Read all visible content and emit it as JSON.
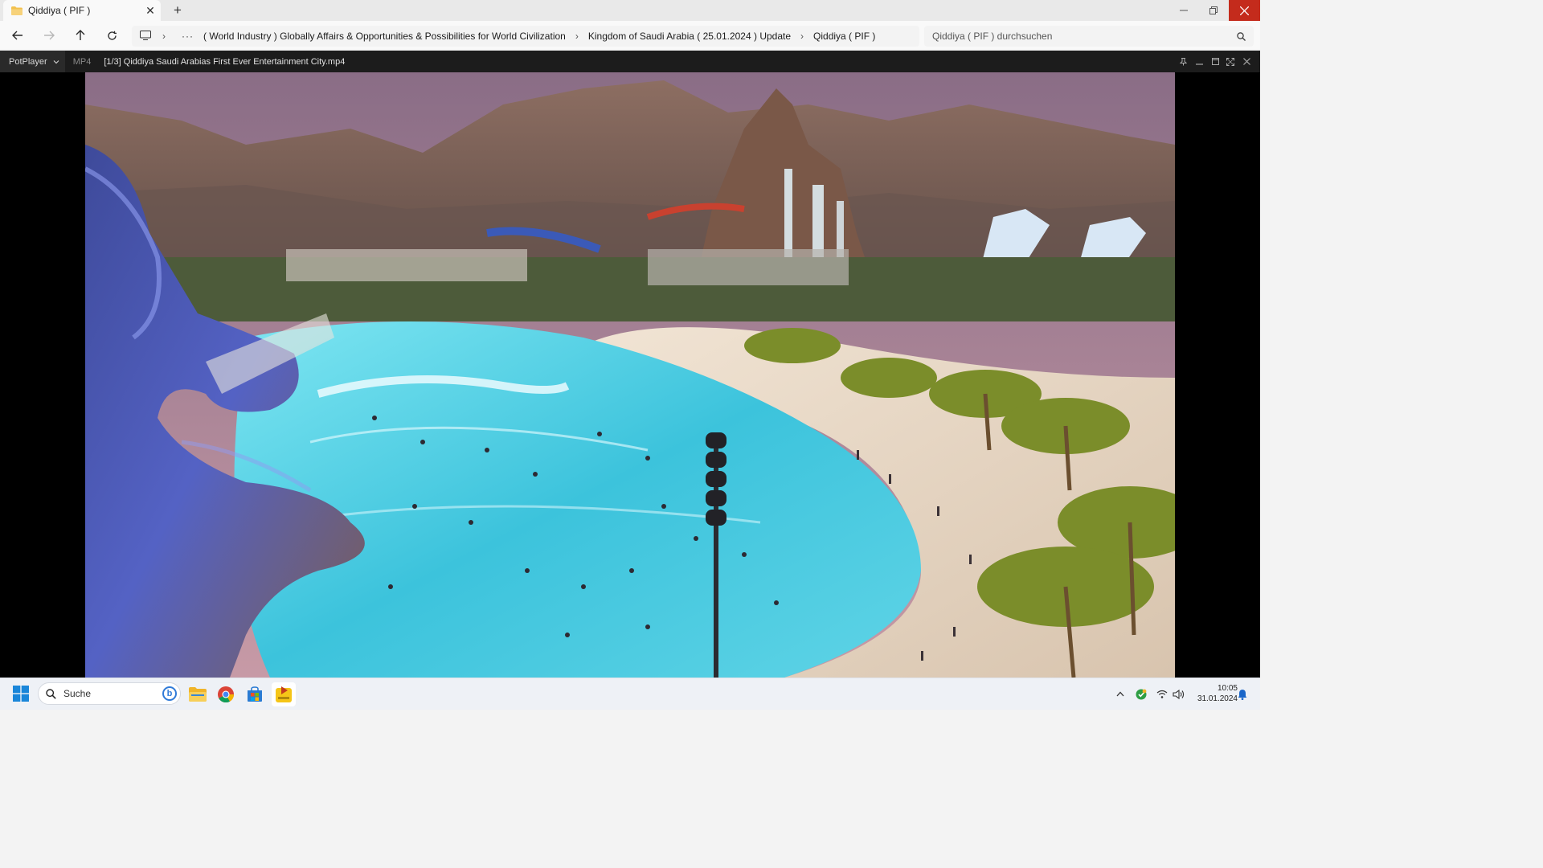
{
  "window": {
    "tab_title": "Qiddiya ( PIF )",
    "new_tab_symbol": "+",
    "close_symbol": "✕",
    "colors": {
      "close_button": "#c42b1c",
      "folder": "#f2c14e"
    }
  },
  "addressbar": {
    "breadcrumbs": [
      "( World Industry ) Globally Affairs & Opportunities & Possibilities for World Civilization",
      "Kingdom of Saudi Arabia ( 25.01.2024 ) Update",
      "Qiddiya ( PIF )"
    ],
    "overflow": "···",
    "search_placeholder": "Qiddiya ( PIF ) durchsuchen"
  },
  "player": {
    "app_name": "PotPlayer",
    "format": "MP4",
    "file_title": "[1/3] Qiddiya  Saudi Arabias First Ever Entertainment City.mp4",
    "icons": [
      "pin-icon",
      "minimize-icon",
      "maximize-icon",
      "fullscreen-icon",
      "close-icon"
    ]
  },
  "taskbar": {
    "search_label": "Suche",
    "bing_letter": "b",
    "apps": [
      "windows-start-icon",
      "file-explorer-icon",
      "chrome-icon",
      "microsoft-store-icon",
      "potplayer-icon"
    ],
    "tray": {
      "chevron": "^",
      "time": "10:05",
      "date": "31.01.2024"
    }
  }
}
